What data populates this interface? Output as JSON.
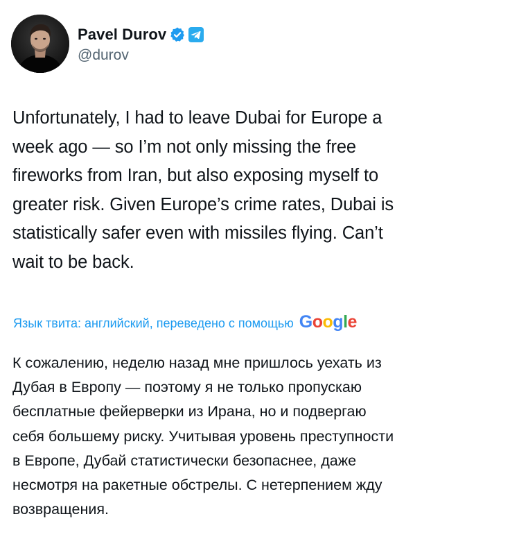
{
  "author": {
    "display_name": "Pavel Durov",
    "handle": "@durov",
    "verified_icon": "verified-badge-icon",
    "secondary_icon": "telegram-icon"
  },
  "tweet": {
    "text_en": "Unfortunately, I had to leave Dubai for Europe a\nweek ago — so I’m not only missing the free\nfireworks from Iran, but also exposing myself to\ngreater risk. Given Europe’s crime rates, Dubai is\nstatistically safer even with missiles flying. Can’t\nwait to be back.",
    "translation_label": "Язык твита: английский, переведено с помощью",
    "translator_logo": {
      "letters": [
        "G",
        "o",
        "o",
        "g",
        "l",
        "e"
      ],
      "colors": [
        "#4285f4",
        "#ea4335",
        "#fbbc05",
        "#4285f4",
        "#34a853",
        "#ea4335"
      ]
    },
    "text_ru": "К сожалению, неделю назад мне пришлось уехать из\nДубая в Европу — поэтому я не только пропускаю\nбесплатные фейерверки из Ирана, но и подвергаю\nсебя большему риску. Учитывая уровень преступности\nв Европе, Дубай статистически безопаснее, даже\nнесмотря на ракетные обстрелы. С нетерпением жду\nвозвращения."
  },
  "colors": {
    "text": "#0f1419",
    "secondary": "#536471",
    "link": "#1d9bf0"
  }
}
